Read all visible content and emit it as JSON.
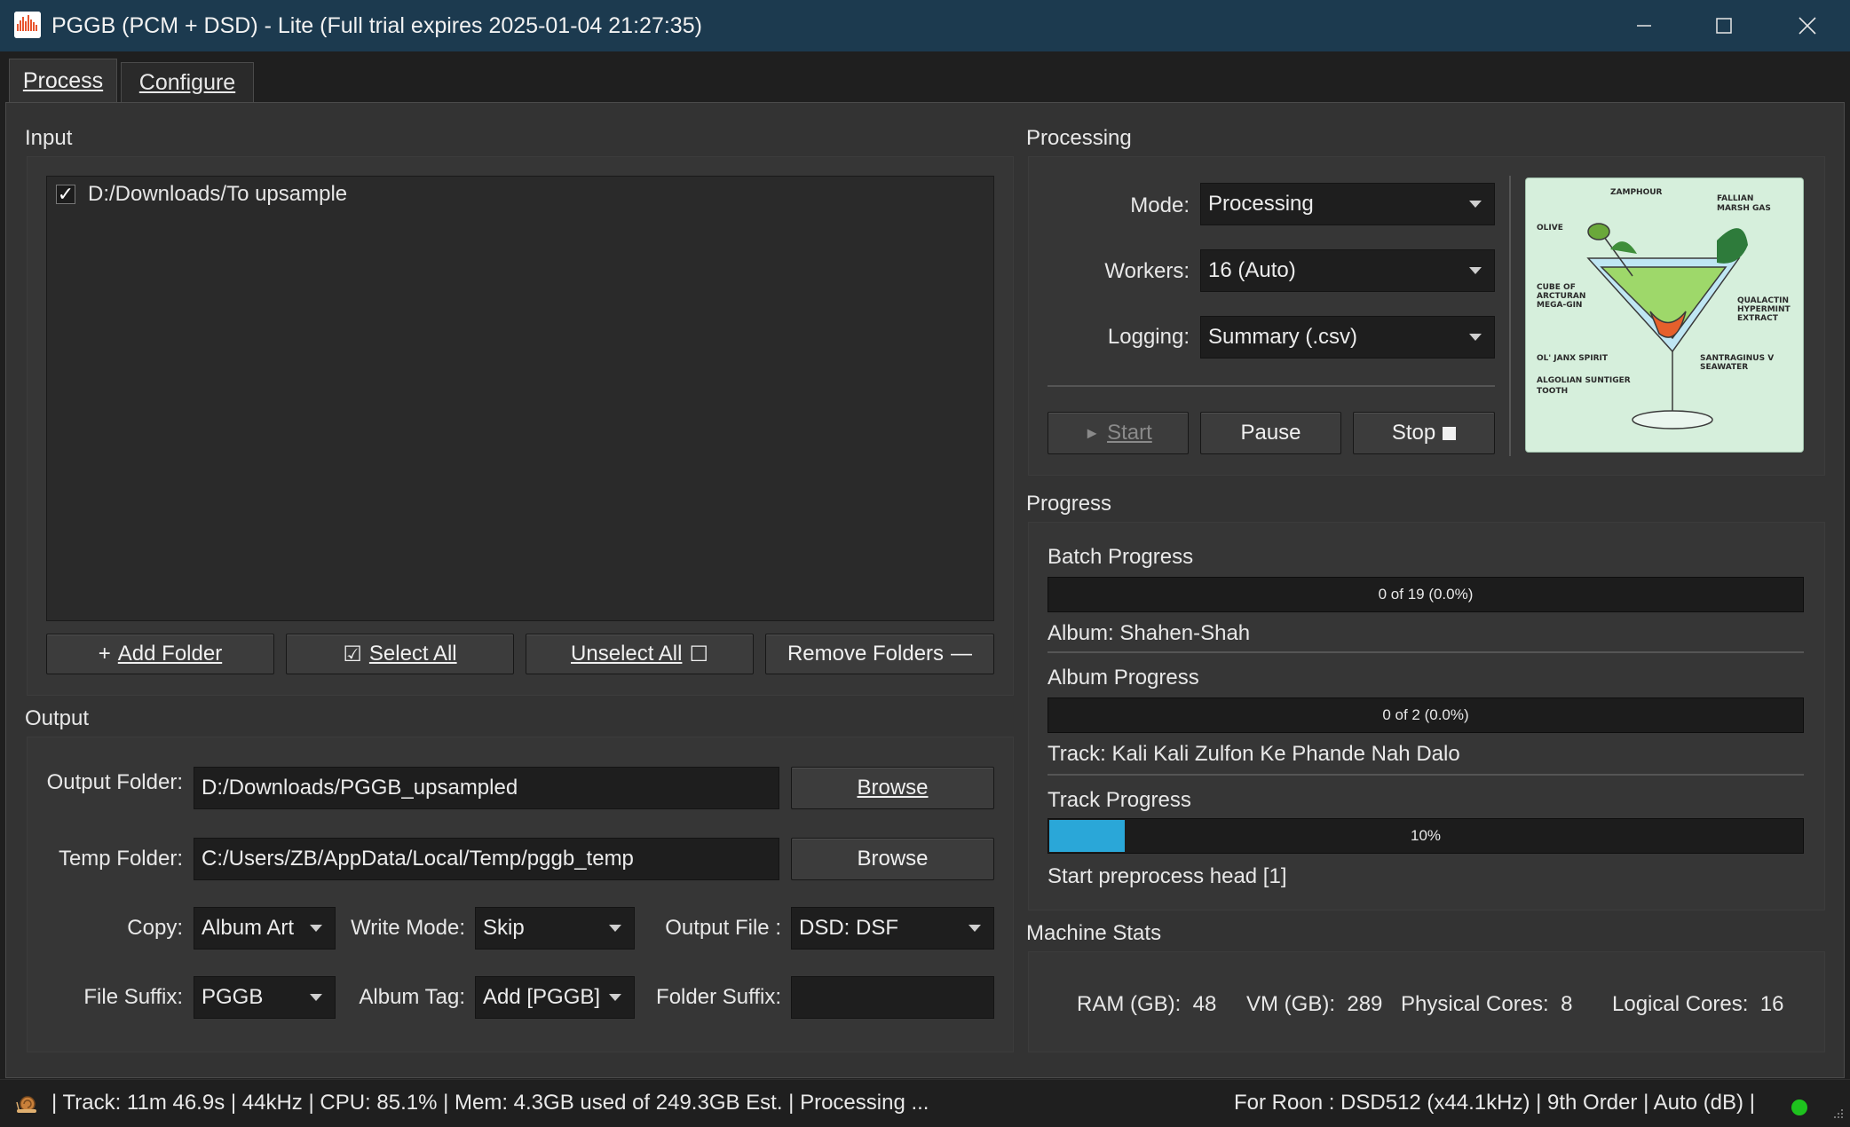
{
  "window": {
    "title": "PGGB (PCM + DSD) - Lite  (Full trial expires  2025-01-04 21:27:35)"
  },
  "tabs": [
    {
      "label": "Process"
    },
    {
      "label": "Configure"
    }
  ],
  "input": {
    "section_label": "Input",
    "folders": [
      {
        "checked": true,
        "path": "D:/Downloads/To upsample"
      }
    ],
    "buttons": {
      "add_folder": "Add Folder",
      "select_all": "Select All",
      "unselect_all": "Unselect All",
      "remove_folders": "Remove Folders"
    }
  },
  "output": {
    "section_label": "Output",
    "output_folder_label": "Output Folder:",
    "output_folder_value": "D:/Downloads/PGGB_upsampled",
    "temp_folder_label": "Temp Folder:",
    "temp_folder_value": "C:/Users/ZB/AppData/Local/Temp/pggb_temp",
    "browse_label": "Browse",
    "copy_label": "Copy:",
    "copy_value": "Album Art",
    "write_mode_label": "Write Mode:",
    "write_mode_value": "Skip",
    "output_file_label": "Output File :",
    "output_file_value": "DSD: DSF",
    "file_suffix_label": "File Suffix:",
    "file_suffix_value": "PGGB",
    "album_tag_label": "Album Tag:",
    "album_tag_value": "Add [PGGB]",
    "folder_suffix_label": "Folder Suffix:",
    "folder_suffix_value": ""
  },
  "processing": {
    "section_label": "Processing",
    "mode_label": "Mode:",
    "mode_value": "Processing",
    "workers_label": "Workers:",
    "workers_value": "16 (Auto)",
    "logging_label": "Logging:",
    "logging_value": "Summary (.csv)",
    "start_label": "Start",
    "pause_label": "Pause",
    "stop_label": "Stop",
    "artwork_icon": "cocktail-illustration"
  },
  "progress": {
    "section_label": "Progress",
    "batch_label": "Batch Progress",
    "batch_text": "0 of 19 (0.0%)",
    "batch_fraction": 0.0,
    "album_info": "Album: Shahen-Shah",
    "album_label": "Album Progress",
    "album_text": "0 of 2 (0.0%)",
    "album_fraction": 0.0,
    "track_info": "Track: Kali Kali Zulfon Ke Phande Nah Dalo",
    "track_label": "Track Progress",
    "track_text": "10%",
    "track_fraction": 0.1,
    "status_info": "Start preprocess head [1]"
  },
  "machine_stats": {
    "section_label": "Machine Stats",
    "ram_label": "RAM (GB):",
    "ram_value": "48",
    "vm_label": "VM (GB):",
    "vm_value": "289",
    "physical_label": "Physical Cores:",
    "physical_value": "8",
    "logical_label": "Logical Cores:",
    "logical_value": "16"
  },
  "statusbar": {
    "left": "|  Track: 11m 46.9s  |  44kHz  |  CPU: 85.1%  |  Mem: 4.3GB used of 249.3GB Est.  |  Processing ...",
    "right": "For Roon   :  DSD512 (x44.1kHz)  |  9th Order  |  Auto (dB)  |",
    "indicator_color": "#1ec21e"
  },
  "colors": {
    "titlebar": "#1c3a4f",
    "progress_fill": "#2aa7d8",
    "background": "#333333"
  }
}
